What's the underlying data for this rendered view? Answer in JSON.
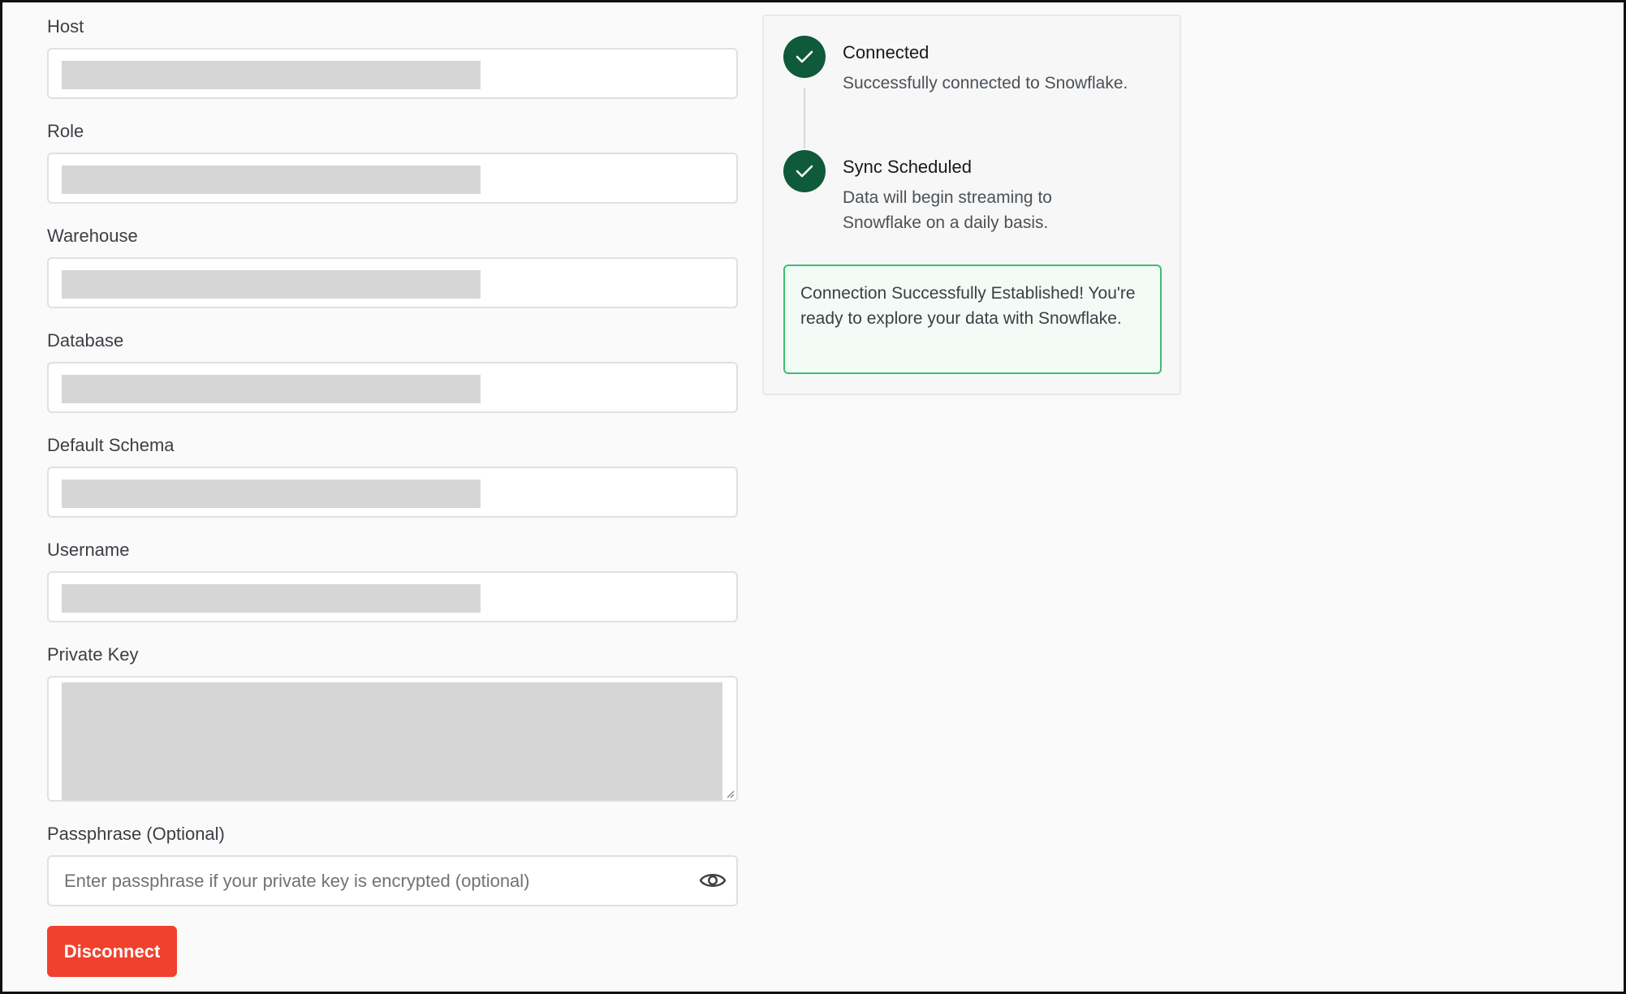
{
  "form": {
    "fields": [
      {
        "label": "Host"
      },
      {
        "label": "Role"
      },
      {
        "label": "Warehouse"
      },
      {
        "label": "Database"
      },
      {
        "label": "Default Schema"
      },
      {
        "label": "Username"
      }
    ],
    "private_key": {
      "label": "Private Key"
    },
    "passphrase": {
      "label": "Passphrase (Optional)",
      "placeholder": "Enter passphrase if your private key is encrypted (optional)",
      "value": ""
    },
    "disconnect_label": "Disconnect"
  },
  "status": {
    "steps": [
      {
        "title": "Connected",
        "description": "Successfully connected to Snowflake.",
        "state": "complete",
        "icon": "check-icon"
      },
      {
        "title": "Sync Scheduled",
        "description": "Data will begin streaming to Snowflake on a daily basis.",
        "state": "complete",
        "icon": "check-icon"
      }
    ],
    "success_message": "Connection Successfully Established! You're ready to explore your data with Snowflake."
  },
  "colors": {
    "accent_danger": "#f0412e",
    "step_complete": "#0e5a3b",
    "success_border": "#3ebe6e",
    "success_bg": "#f2fbf5"
  }
}
